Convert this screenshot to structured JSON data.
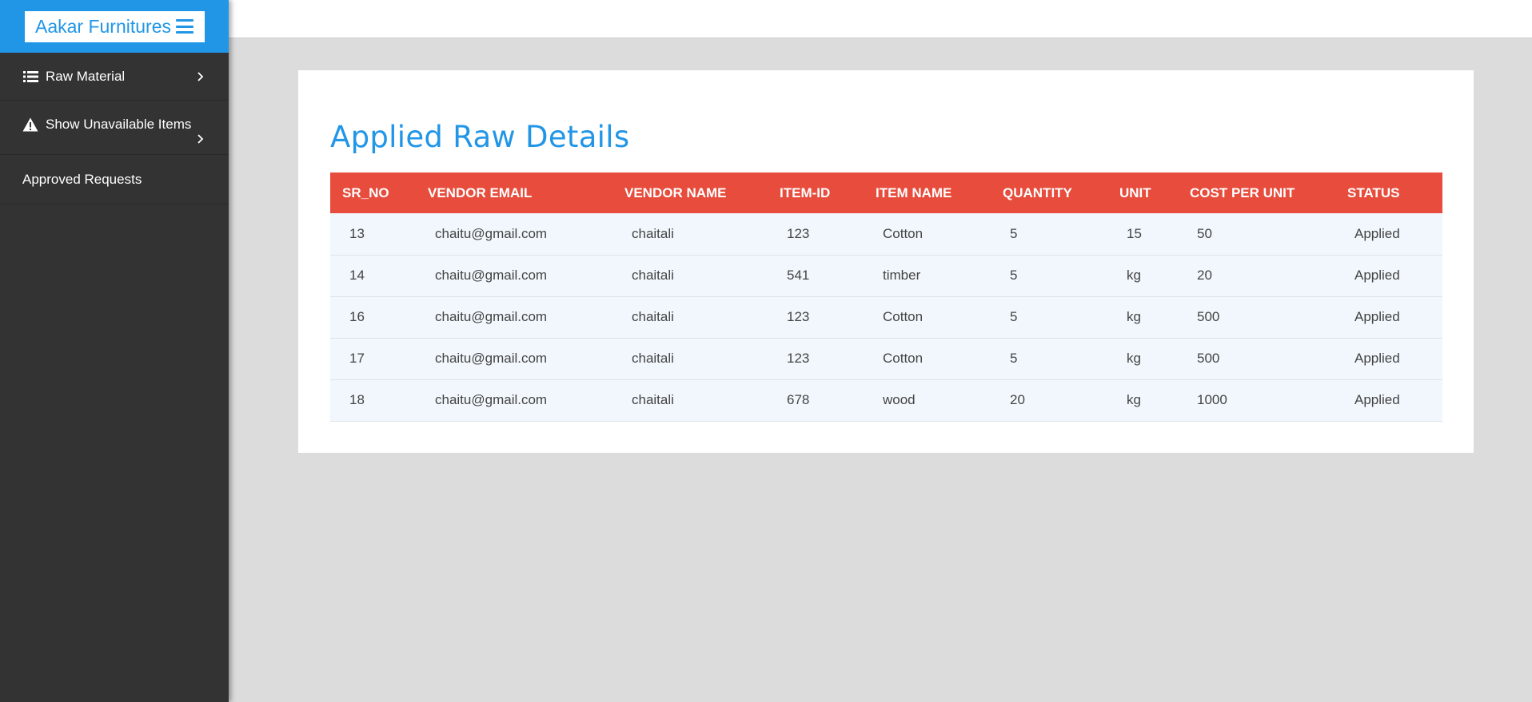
{
  "brand": {
    "name": "Aakar Furnitures"
  },
  "sidebar": {
    "items": [
      {
        "label": "Raw Material"
      },
      {
        "label": "Show Unavailable Items"
      },
      {
        "label": "Approved Requests"
      }
    ]
  },
  "search": {
    "placeholder": ""
  },
  "main": {
    "title": "Applied Raw Details",
    "table": {
      "headers": [
        "SR_NO",
        "VENDOR EMAIL",
        "VENDOR NAME",
        "ITEM-ID",
        "ITEM NAME",
        "QUANTITY",
        "UNIT",
        "COST PER UNIT",
        "STATUS"
      ],
      "rows": [
        [
          "13",
          "chaitu@gmail.com",
          "chaitali",
          "123",
          "Cotton",
          "5",
          "15",
          "50",
          "Applied"
        ],
        [
          "14",
          "chaitu@gmail.com",
          "chaitali",
          "541",
          "timber",
          "5",
          "kg",
          "20",
          "Applied"
        ],
        [
          "16",
          "chaitu@gmail.com",
          "chaitali",
          "123",
          "Cotton",
          "5",
          "kg",
          "500",
          "Applied"
        ],
        [
          "17",
          "chaitu@gmail.com",
          "chaitali",
          "123",
          "Cotton",
          "5",
          "kg",
          "500",
          "Applied"
        ],
        [
          "18",
          "chaitu@gmail.com",
          "chaitali",
          "678",
          "wood",
          "20",
          "kg",
          "1000",
          "Applied"
        ]
      ]
    }
  },
  "colors": {
    "brand_blue": "#2196e6",
    "sidebar_bg": "#333333",
    "table_header_bg": "#e74c3c",
    "row_bg": "#f1f7fc",
    "page_bg": "#dcdcdc"
  },
  "icons": {
    "brand_menu": "hamburger-icon",
    "raw_material": "list-icon",
    "unavailable": "warning-icon",
    "submenu": "chevron-right-icon",
    "search": "search-icon"
  }
}
